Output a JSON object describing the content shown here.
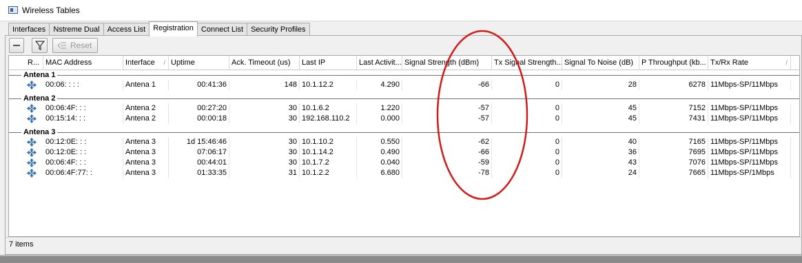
{
  "window": {
    "title": "Wireless Tables"
  },
  "tabs": [
    {
      "label": "Interfaces"
    },
    {
      "label": "Nstreme Dual"
    },
    {
      "label": "Access List"
    },
    {
      "label": "Registration"
    },
    {
      "label": "Connect List"
    },
    {
      "label": "Security Profiles"
    }
  ],
  "active_tab": "Registration",
  "toolbar": {
    "reset_label": "Reset"
  },
  "columns": [
    {
      "label": "R..."
    },
    {
      "label": "MAC Address"
    },
    {
      "label": "Interface"
    },
    {
      "label": "Uptime"
    },
    {
      "label": "Ack. Timeout (us)"
    },
    {
      "label": "Last IP"
    },
    {
      "label": "Last Activit..."
    },
    {
      "label": "Signal Strength (dBm)"
    },
    {
      "label": "Tx Signal Strength..."
    },
    {
      "label": "Signal To Noise (dB)"
    },
    {
      "label": "P Throughput (kb..."
    },
    {
      "label": "Tx/Rx Rate"
    }
  ],
  "sort_indicator": "/",
  "groups": [
    {
      "label": "Antena 1",
      "rows": [
        {
          "mac": "00:06:  :  :  :  ",
          "interface": "Antena 1",
          "uptime": "00:41:36",
          "ack_timeout": "148",
          "last_ip": "10.1.12.2",
          "last_activity": "4.290",
          "signal": "-66",
          "tx_signal": "0",
          "snr": "28",
          "p_throughput": "6278",
          "rate": "11Mbps-SP/11Mbps"
        }
      ]
    },
    {
      "label": "Antena 2",
      "rows": [
        {
          "mac": "00:06:4F:  :  :  ",
          "interface": "Antena 2",
          "uptime": "00:27:20",
          "ack_timeout": "30",
          "last_ip": "10.1.6.2",
          "last_activity": "1.220",
          "signal": "-57",
          "tx_signal": "0",
          "snr": "45",
          "p_throughput": "7152",
          "rate": "11Mbps-SP/11Mbps"
        },
        {
          "mac": "00:15:14:  :  :  ",
          "interface": "Antena 2",
          "uptime": "00:00:18",
          "ack_timeout": "30",
          "last_ip": "192.168.110.2",
          "last_activity": "0.000",
          "signal": "-57",
          "tx_signal": "0",
          "snr": "45",
          "p_throughput": "7431",
          "rate": "11Mbps-SP/11Mbps"
        }
      ]
    },
    {
      "label": "Antena 3",
      "rows": [
        {
          "mac": "00:12:0E:  :  :  ",
          "interface": "Antena 3",
          "uptime": "1d 15:46:46",
          "ack_timeout": "30",
          "last_ip": "10.1.10.2",
          "last_activity": "0.550",
          "signal": "-62",
          "tx_signal": "0",
          "snr": "40",
          "p_throughput": "7165",
          "rate": "11Mbps-SP/11Mbps"
        },
        {
          "mac": "00:12:0E:  :  :  ",
          "interface": "Antena 3",
          "uptime": "07:06:17",
          "ack_timeout": "30",
          "last_ip": "10.1.14.2",
          "last_activity": "0.490",
          "signal": "-66",
          "tx_signal": "0",
          "snr": "36",
          "p_throughput": "7695",
          "rate": "11Mbps-SP/11Mbps"
        },
        {
          "mac": "00:06:4F:  :  :  ",
          "interface": "Antena 3",
          "uptime": "00:44:01",
          "ack_timeout": "30",
          "last_ip": "10.1.7.2",
          "last_activity": "0.040",
          "signal": "-59",
          "tx_signal": "0",
          "snr": "43",
          "p_throughput": "7076",
          "rate": "11Mbps-SP/11Mbps"
        },
        {
          "mac": "00:06:4F:77:  :  ",
          "interface": "Antena 3",
          "uptime": "01:33:35",
          "ack_timeout": "31",
          "last_ip": "10.1.2.2",
          "last_activity": "6.680",
          "signal": "-78",
          "tx_signal": "0",
          "snr": "24",
          "p_throughput": "7665",
          "rate": "11Mbps-SP/1Mbps"
        }
      ]
    }
  ],
  "status": {
    "items_count": "7 items"
  },
  "colors": {
    "highlight_ellipse": "#d11a1a",
    "row_icon": "#2f6fb0"
  },
  "icons": {
    "row": "wireless-client-icon",
    "filter": "filter-icon",
    "minus": "minus-icon",
    "reset": "reset-icon"
  }
}
